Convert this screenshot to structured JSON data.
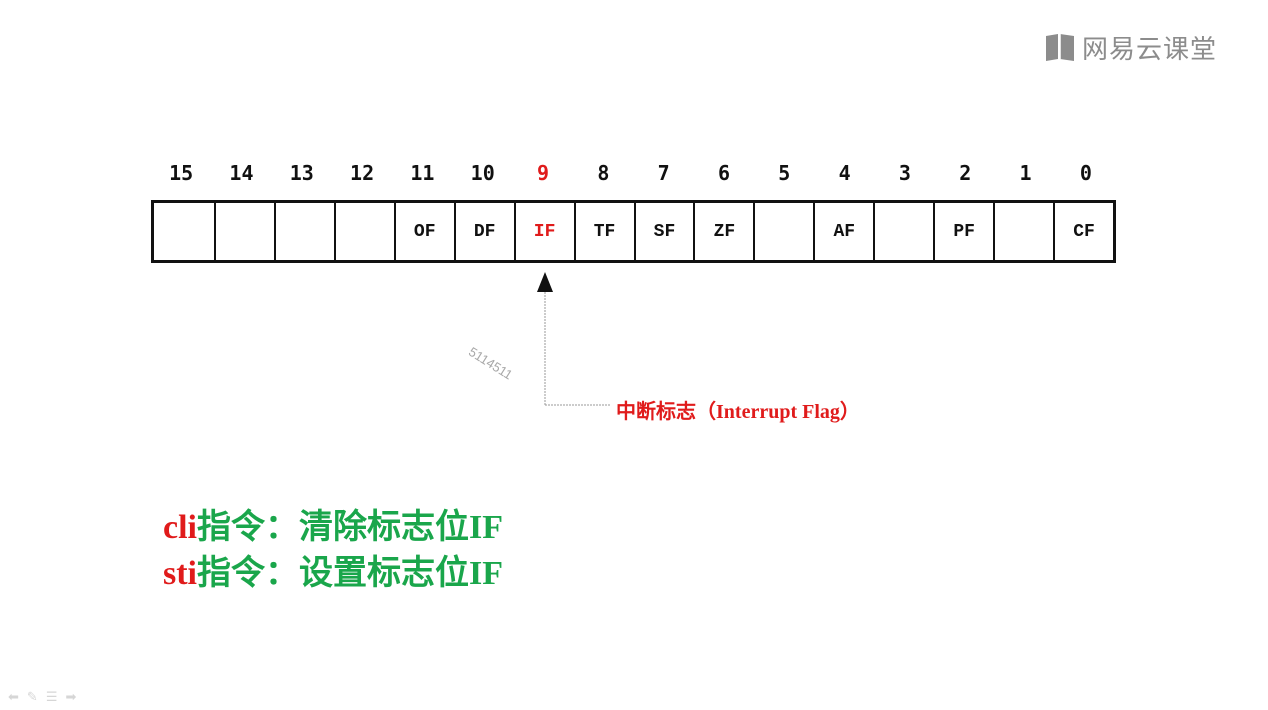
{
  "logo": {
    "text": "网易云课堂",
    "icon": "book-icon"
  },
  "register": {
    "bit_numbers": [
      "15",
      "14",
      "13",
      "12",
      "11",
      "10",
      "9",
      "8",
      "7",
      "6",
      "5",
      "4",
      "3",
      "2",
      "1",
      "0"
    ],
    "cells": [
      "",
      "",
      "",
      "",
      "OF",
      "DF",
      "IF",
      "TF",
      "SF",
      "ZF",
      "",
      "AF",
      "",
      "PF",
      "",
      "CF"
    ],
    "highlight_color": "#e01b1b",
    "text_color": "#111111"
  },
  "watermark": "5114511",
  "flag_label": "中断标志（Interrupt Flag）",
  "instructions": [
    {
      "cmd": "cli",
      "desc": "指令：清除标志位IF"
    },
    {
      "cmd": "sti",
      "desc": "指令：设置标志位IF"
    }
  ],
  "colors": {
    "command": "#e01b1b",
    "description": "#1aa64b"
  },
  "player_controls": [
    "arrow-left-icon",
    "pen-icon",
    "menu-icon",
    "arrow-right-icon"
  ]
}
